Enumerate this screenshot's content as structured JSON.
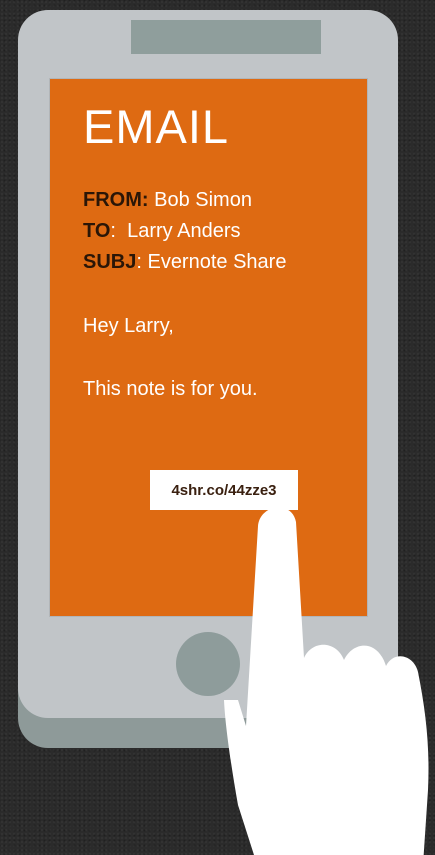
{
  "email": {
    "title": "EMAIL",
    "from_label": "FROM:",
    "from_value": " Bob Simon",
    "to_label": "TO",
    "to_value": ":  Larry Anders",
    "subj_label": "SUBJ",
    "subj_value": ": Evernote Share",
    "greeting": "Hey Larry,",
    "message": "This note is for you.",
    "link_text": "4shr.co/44zze3"
  },
  "colors": {
    "background": "#2b2b2b",
    "phone_body": "#c1c5c8",
    "phone_accent": "#8f9e9c",
    "screen": "#de6a12",
    "label_text": "#2a1607"
  },
  "icons": {
    "pointer": "hand-pointer-icon"
  }
}
